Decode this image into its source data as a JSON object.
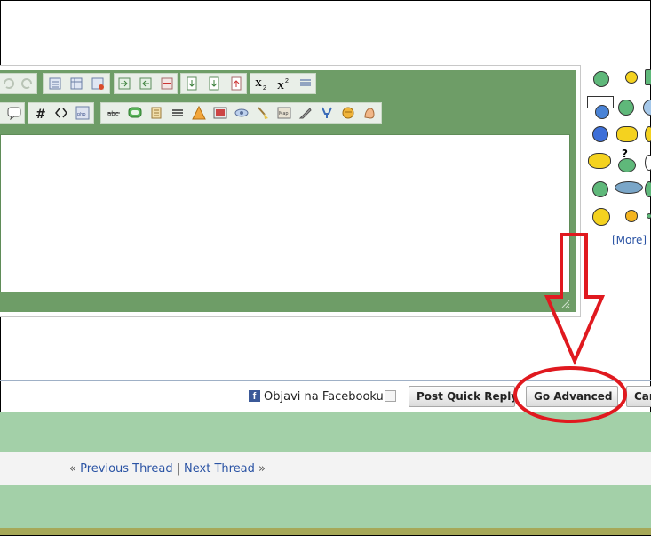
{
  "smilies_more": "[More]",
  "facebook": {
    "icon": "f",
    "label": "Objavi na Facebooku"
  },
  "buttons": {
    "quick_reply": "Post Quick Reply",
    "go_advanced": "Go Advanced",
    "cancel": "Cancel"
  },
  "thread_nav": {
    "prev_arrow": "«",
    "prev": "Previous Thread",
    "divider": "|",
    "next": "Next Thread",
    "next_arrow": "»"
  },
  "toolbar_icons": {
    "row1": [
      "undo-icon",
      "redo-icon",
      "list-icon",
      "table-icon",
      "table-remove-icon",
      "indent-icon",
      "outdent-icon",
      "remove-icon",
      "page-icon",
      "page-down-icon",
      "page-up-icon",
      "subscript-icon",
      "superscript-icon",
      "align-icon"
    ],
    "row2": [
      "quote-icon",
      "hash-icon",
      "code-icon",
      "php-icon",
      "strike-icon",
      "bubble-icon",
      "scroll-icon",
      "hr-icon",
      "warning-icon",
      "image-icon",
      "spoiler-icon",
      "broom-icon",
      "map-icon",
      "knife-icon",
      "cup-icon",
      "box-icon",
      "hand-icon"
    ],
    "row1_labels": {
      "subscript": "X2",
      "superscript": "X2"
    },
    "row2_labels": {
      "hash": "#",
      "code": "<>",
      "php": "php",
      "strike": "abc"
    }
  },
  "colors": {
    "editor_green": "#6e9d67",
    "band_green": "#a3d0a8",
    "link": "#2a53a4",
    "annotation": "#e0191f"
  }
}
